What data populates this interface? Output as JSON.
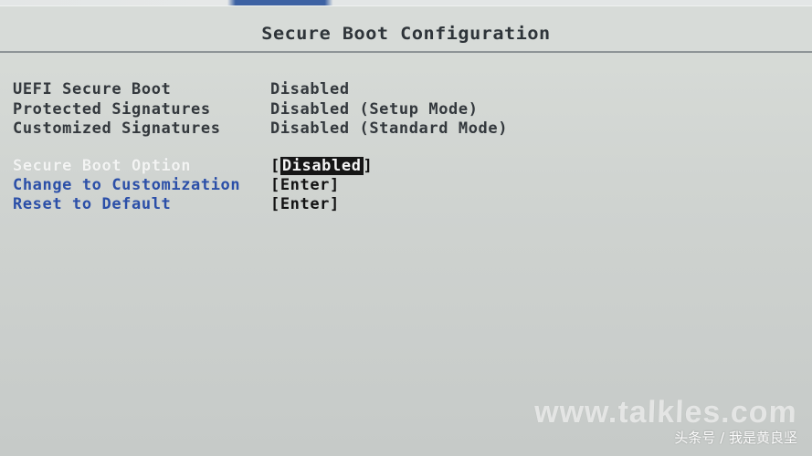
{
  "header": {
    "title": "Secure Boot Configuration"
  },
  "status": {
    "uefi_secure_boot": {
      "label": "UEFI Secure Boot",
      "value": "Disabled"
    },
    "protected_signatures": {
      "label": "Protected Signatures",
      "value": "Disabled (Setup Mode)"
    },
    "customized_signatures": {
      "label": "Customized Signatures",
      "value": "Disabled (Standard Mode)"
    }
  },
  "options": {
    "secure_boot_option": {
      "label": "Secure Boot Option",
      "value": "Disabled"
    },
    "change_to_customization": {
      "label": "Change to Customization",
      "value": "[Enter]"
    },
    "reset_to_default": {
      "label": "Reset to Default",
      "value": "[Enter]"
    }
  },
  "overlay": {
    "watermark": "www.talkles.com",
    "caption": "头条号 / 我是黄良坚"
  }
}
